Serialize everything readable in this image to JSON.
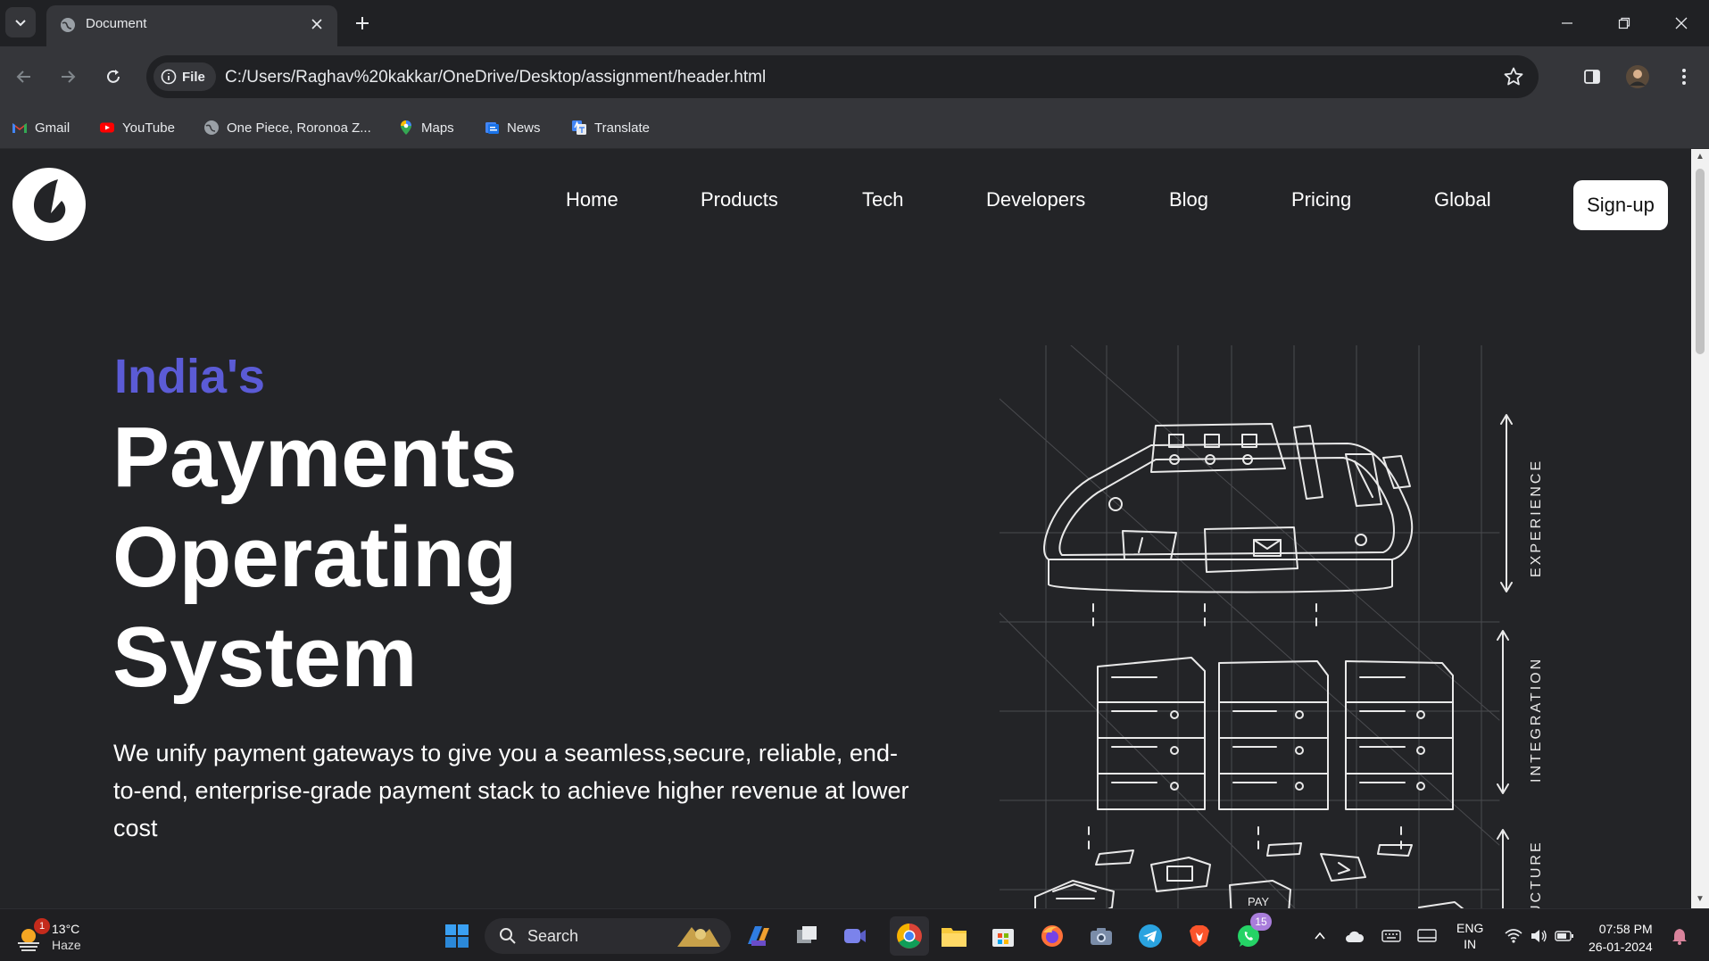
{
  "browser": {
    "tab_title": "Document",
    "url_chip": "File",
    "url": "C:/Users/Raghav%20kakkar/OneDrive/Desktop/assignment/header.html",
    "bookmarks": [
      {
        "label": "Gmail",
        "icon": "gmail-icon"
      },
      {
        "label": "YouTube",
        "icon": "youtube-icon"
      },
      {
        "label": "One Piece, Roronoa Z...",
        "icon": "globe-icon"
      },
      {
        "label": "Maps",
        "icon": "maps-icon"
      },
      {
        "label": "News",
        "icon": "news-icon"
      },
      {
        "label": "Translate",
        "icon": "translate-icon"
      }
    ]
  },
  "site": {
    "nav": [
      "Home",
      "Products",
      "Tech",
      "Developers",
      "Blog",
      "Pricing",
      "Global"
    ],
    "signup_label": "Sign-up",
    "eyebrow": "India's",
    "headline": [
      "Payments",
      "Operating",
      "System"
    ],
    "lead": "We unify payment gateways to give you a seamless,secure, reliable, end-to-end, enterprise-grade payment stack to achieve higher revenue at lower cost",
    "illustration_labels": [
      "EXPERIENCE",
      "INTEGRATION",
      "STRUCTURE",
      "PAY"
    ],
    "colors": {
      "accent": "#5b5bd6",
      "background": "#232427",
      "text": "#ffffff"
    }
  },
  "taskbar": {
    "weather_temp": "13°C",
    "weather_desc": "Haze",
    "weather_badge": "1",
    "search_placeholder": "Search",
    "whatsapp_badge": "15",
    "lang_line1": "ENG",
    "lang_line2": "IN",
    "time": "07:58 PM",
    "date": "26-01-2024"
  }
}
